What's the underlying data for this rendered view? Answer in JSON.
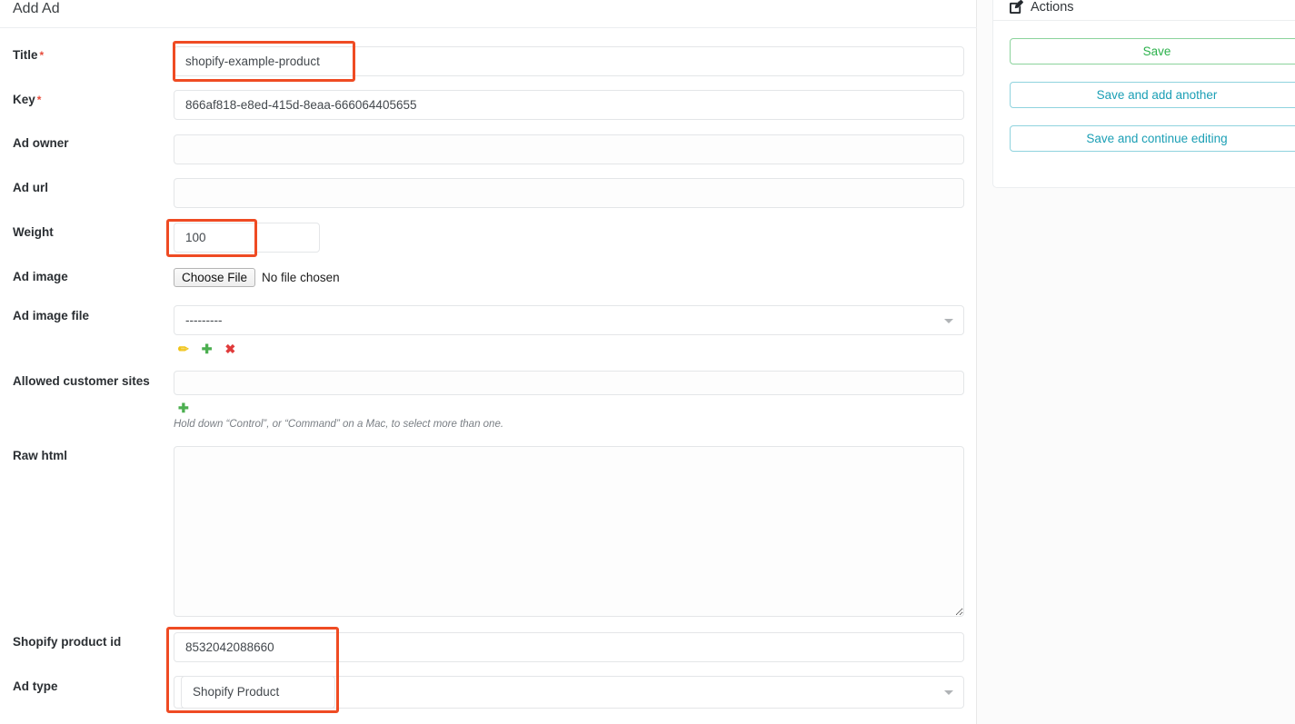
{
  "page": {
    "title": "Add Ad"
  },
  "form": {
    "fields": [
      {
        "label": "Title",
        "required": true,
        "value": "shopify-example-product",
        "type": "text"
      },
      {
        "label": "Key",
        "required": true,
        "value": "866af818-e8ed-415d-8eaa-666064405655",
        "type": "text"
      },
      {
        "label": "Ad owner",
        "required": false,
        "value": "",
        "type": "text"
      },
      {
        "label": "Ad url",
        "required": false,
        "value": "",
        "type": "text"
      },
      {
        "label": "Weight",
        "required": false,
        "value": "100",
        "type": "number"
      },
      {
        "label": "Ad image",
        "required": false,
        "type": "file"
      },
      {
        "label": "Ad image file",
        "required": false,
        "value": "---------",
        "type": "select"
      },
      {
        "label": "Allowed customer sites",
        "required": false,
        "value": "",
        "type": "multiselect"
      },
      {
        "label": "Raw html",
        "required": false,
        "value": "",
        "type": "textarea"
      },
      {
        "label": "Shopify product id",
        "required": false,
        "value": "8532042088660",
        "type": "text"
      },
      {
        "label": "Ad type",
        "required": false,
        "value": "Shopify Product",
        "type": "select"
      }
    ],
    "file_input": {
      "button_label": "Choose File",
      "status": "No file chosen"
    },
    "ad_image_file_select": {
      "selected": "---------",
      "options": [
        "---------"
      ]
    },
    "related_widget_icons": {
      "edit": "✏",
      "add": "✚",
      "delete": "✖"
    },
    "allowed_sites_help": "Hold down “Control”, or “Command” on a Mac, to select more than one.",
    "ad_type_select": {
      "selected": "Shopify Product",
      "options": [
        "Shopify Product"
      ],
      "open_option_label": "Shopify Product"
    }
  },
  "actions": {
    "title": "Actions",
    "buttons": [
      {
        "label": "Save",
        "color": "#2bb14b"
      },
      {
        "label": "Save and add another",
        "color": "#1b9fb5"
      },
      {
        "label": "Save and continue editing",
        "color": "#1b9fb5"
      }
    ]
  },
  "highlights": {
    "accent_color": "#ef4b23",
    "regions": [
      "title-field",
      "weight-field",
      "shopify-product-id-and-ad-type"
    ]
  }
}
